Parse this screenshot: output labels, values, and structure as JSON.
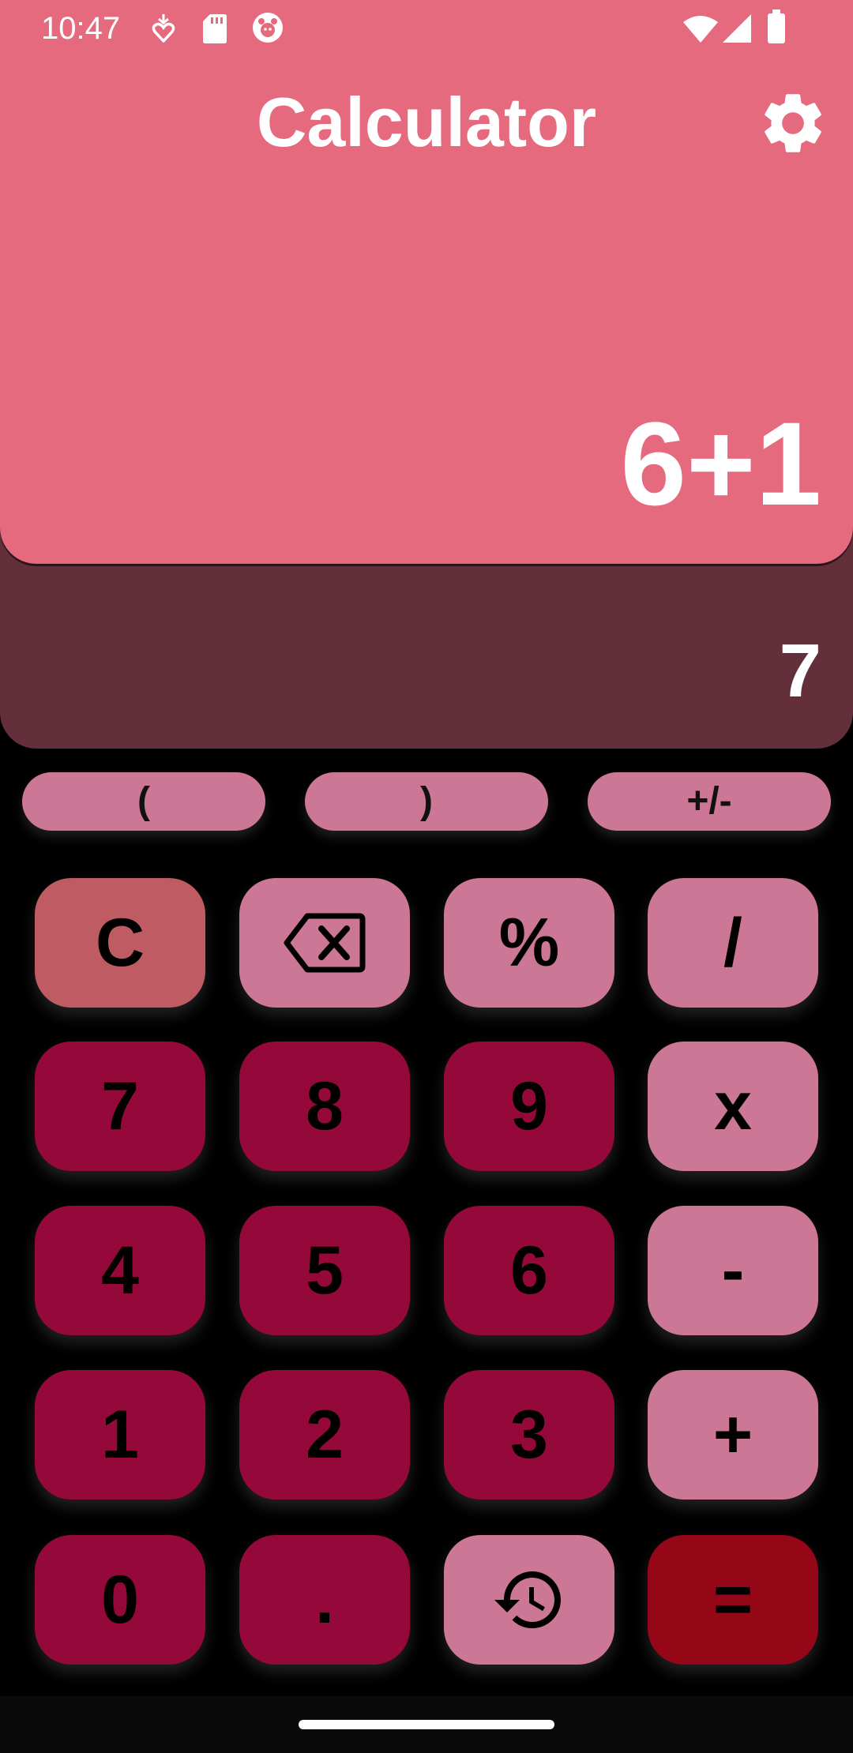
{
  "status_bar": {
    "time": "10:47"
  },
  "app": {
    "title": "Calculator"
  },
  "display": {
    "expression": "6+1",
    "result": "7"
  },
  "pills": [
    {
      "label": "("
    },
    {
      "label": ")"
    },
    {
      "label": "+/-"
    }
  ],
  "keys": {
    "clear": "C",
    "percent": "%",
    "divide": "/",
    "seven": "7",
    "eight": "8",
    "nine": "9",
    "multiply": "x",
    "four": "4",
    "five": "5",
    "six": "6",
    "minus": "-",
    "one": "1",
    "two": "2",
    "three": "3",
    "plus": "+",
    "zero": "0",
    "dot": ".",
    "equals": "="
  },
  "colors": {
    "header": "#e56a7e",
    "result_band": "#632f3b",
    "number_key": "#95093a",
    "operator_key": "#cc7795",
    "clear_key": "#bf5b63",
    "equals_key": "#950616",
    "background": "#000000"
  },
  "icons": {
    "settings": "gear-icon",
    "backspace": "backspace-icon",
    "history": "history-icon",
    "wifi": "wifi-icon",
    "signal": "signal-icon",
    "battery": "battery-icon"
  }
}
